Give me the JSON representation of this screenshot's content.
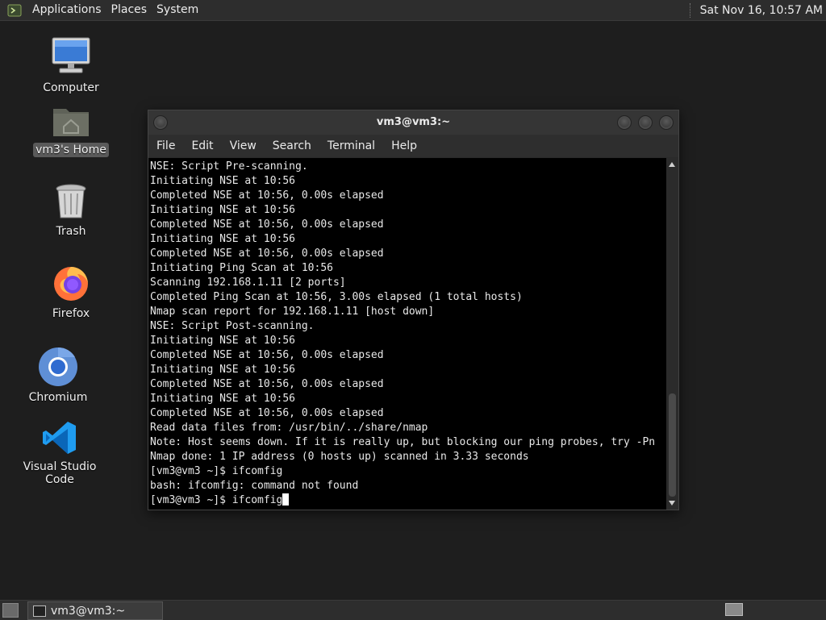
{
  "top_panel": {
    "menu": [
      "Applications",
      "Places",
      "System"
    ],
    "clock": "Sat Nov 16, 10:57 AM"
  },
  "desktop": {
    "icons": [
      {
        "label": "Computer",
        "icon": "computer-icon"
      },
      {
        "label": "vm3's Home",
        "icon": "home-folder-icon"
      },
      {
        "label": "Trash",
        "icon": "trash-icon"
      },
      {
        "label": "Firefox",
        "icon": "firefox-icon"
      },
      {
        "label": "Chromium",
        "icon": "chromium-icon"
      },
      {
        "label": "Visual Studio Code",
        "icon": "vscode-icon"
      }
    ]
  },
  "terminal": {
    "title": "vm3@vm3:~",
    "menu": [
      "File",
      "Edit",
      "View",
      "Search",
      "Terminal",
      "Help"
    ],
    "lines": [
      "NSE: Script Pre-scanning.",
      "Initiating NSE at 10:56",
      "Completed NSE at 10:56, 0.00s elapsed",
      "Initiating NSE at 10:56",
      "Completed NSE at 10:56, 0.00s elapsed",
      "Initiating NSE at 10:56",
      "Completed NSE at 10:56, 0.00s elapsed",
      "Initiating Ping Scan at 10:56",
      "Scanning 192.168.1.11 [2 ports]",
      "Completed Ping Scan at 10:56, 3.00s elapsed (1 total hosts)",
      "Nmap scan report for 192.168.1.11 [host down]",
      "NSE: Script Post-scanning.",
      "Initiating NSE at 10:56",
      "Completed NSE at 10:56, 0.00s elapsed",
      "Initiating NSE at 10:56",
      "Completed NSE at 10:56, 0.00s elapsed",
      "Initiating NSE at 10:56",
      "Completed NSE at 10:56, 0.00s elapsed",
      "Read data files from: /usr/bin/../share/nmap",
      "Note: Host seems down. If it is really up, but blocking our ping probes, try -Pn",
      "Nmap done: 1 IP address (0 hosts up) scanned in 3.33 seconds",
      "[vm3@vm3 ~]$ ifcomfig",
      "bash: ifcomfig: command not found",
      "[vm3@vm3 ~]$ ifcomfig"
    ]
  },
  "taskbar": {
    "window_title": "vm3@vm3:~"
  }
}
